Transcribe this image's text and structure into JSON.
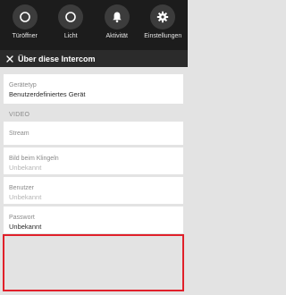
{
  "toolbar": {
    "actions": [
      {
        "label": "Türöffner",
        "icon": "circle-icon"
      },
      {
        "label": "Licht",
        "icon": "circle-icon"
      },
      {
        "label": "Aktivität",
        "icon": "bell-icon"
      },
      {
        "label": "Einstellungen",
        "icon": "gear-icon"
      }
    ]
  },
  "header": {
    "title": "Über diese Intercom",
    "close_icon": "close-icon"
  },
  "device": {
    "type_label": "Gerätetyp",
    "type_value": "Benutzerdefiniertes Gerät"
  },
  "video": {
    "section_label": "VIDEO",
    "stream_label": "Stream",
    "image_label": "Bild beim Klingeln",
    "image_value": "Unbekannt",
    "user_label": "Benutzer",
    "user_value": "Unbekannt",
    "password_label": "Passwort",
    "password_value": "Unbekannt"
  },
  "colors": {
    "topbar_bg": "#1c1c1c",
    "header_bg": "#2b2b2b",
    "content_bg": "#e3e3e3",
    "highlight_border": "#e0202a"
  }
}
